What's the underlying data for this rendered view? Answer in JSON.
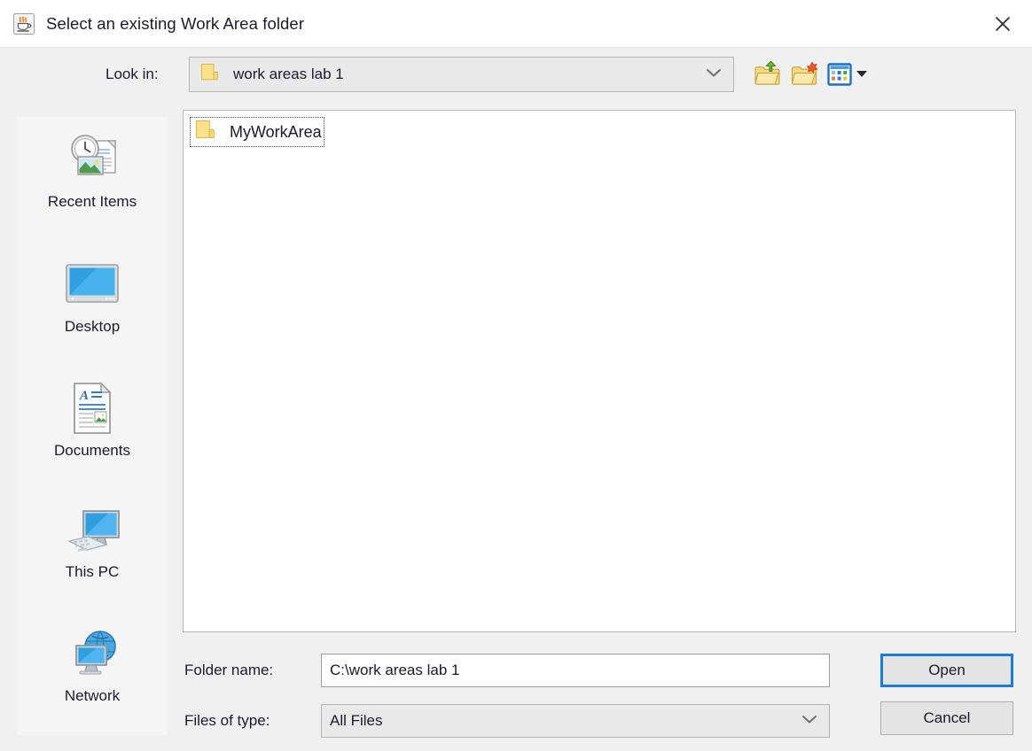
{
  "window": {
    "title": "Select an existing Work Area folder",
    "title_icon": "java-coffee-cup-icon",
    "close_label": "✕"
  },
  "lookin": {
    "label": "Look in:",
    "value": "work areas lab 1",
    "icon": "folder-icon",
    "dropdown_icon": "chevron-down-icon"
  },
  "toolbar": {
    "buttons": [
      {
        "name": "up-one-level-button",
        "icon": "folder-up-arrow-icon",
        "tooltip": "Up One Level"
      },
      {
        "name": "create-new-folder-button",
        "icon": "folder-new-star-icon",
        "tooltip": "Create New Folder"
      },
      {
        "name": "view-menu-button",
        "icon": "view-grid-icon",
        "tooltip": "View Menu"
      }
    ]
  },
  "shortcuts": [
    {
      "label": "Recent Items",
      "icon": "recent-items-icon"
    },
    {
      "label": "Desktop",
      "icon": "desktop-monitor-icon"
    },
    {
      "label": "Documents",
      "icon": "documents-page-icon"
    },
    {
      "label": "This PC",
      "icon": "this-pc-computer-icon"
    },
    {
      "label": "Network",
      "icon": "network-globe-icon"
    }
  ],
  "filelist": {
    "items": [
      {
        "name": "MyWorkArea",
        "icon": "folder-icon",
        "selected": true
      }
    ]
  },
  "form": {
    "folder_name_label": "Folder name:",
    "folder_name_value": "C:\\work areas lab 1",
    "folder_name_placeholder": "",
    "files_of_type_label": "Files of type:",
    "files_of_type_value": "All Files",
    "files_of_type_options": [
      "All Files"
    ]
  },
  "buttons": {
    "open_label": "Open",
    "cancel_label": "Cancel"
  },
  "colors": {
    "accent": "#1a7ddc",
    "window_bg": "#f0f0f0",
    "titlebar_bg": "#ffffff",
    "panel_bg": "#f5f5f5",
    "list_bg": "#ffffff",
    "folder_yellow": "#fbe08a"
  }
}
